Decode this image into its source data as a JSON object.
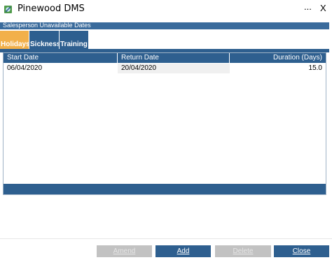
{
  "window": {
    "title": "Pinewood DMS",
    "more_glyph": "...",
    "close_glyph": "X"
  },
  "section": {
    "title": "Salesperson Unavailable Dates"
  },
  "tabs": [
    {
      "label": "Holidays",
      "active": true
    },
    {
      "label": "Sickness",
      "active": false
    },
    {
      "label": "Training",
      "active": false
    }
  ],
  "table": {
    "columns": [
      "Start Date",
      "Return Date",
      "Duration (Days)"
    ],
    "rows": [
      {
        "start": "06/04/2020",
        "return": "20/04/2020",
        "duration": "15.0"
      }
    ]
  },
  "buttons": {
    "amend": "Amend",
    "add": "Add",
    "delete": "Delete",
    "close": "Close"
  },
  "colors": {
    "header_blue": "#2e5f8f",
    "section_blue": "#3a6b9c",
    "active_tab": "#f2b04a",
    "disabled_button": "#c2c2c2"
  },
  "icons": {
    "app": "pinewood-app-icon"
  }
}
